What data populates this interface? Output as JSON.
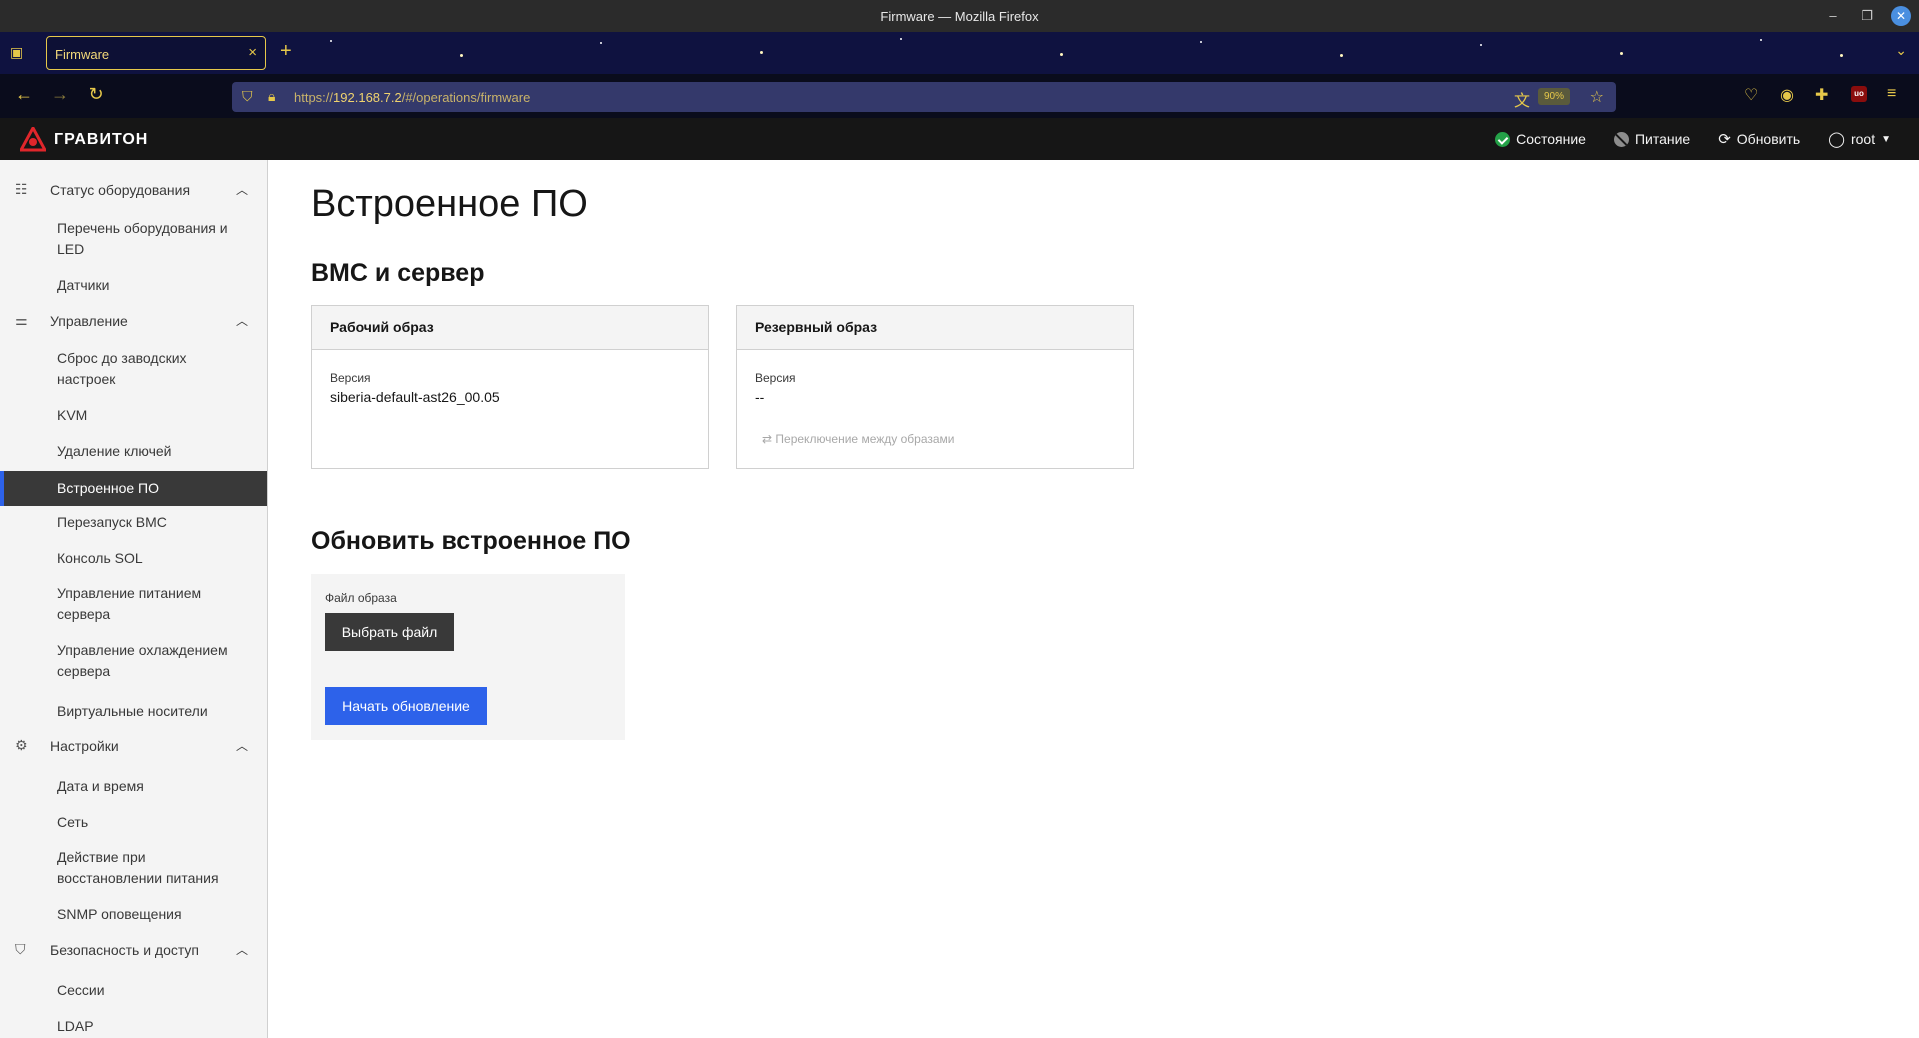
{
  "window": {
    "title": "Firmware — Mozilla Firefox"
  },
  "browser": {
    "tab_title": "Firmware",
    "tab_close": "×",
    "new_tab": "+",
    "url_prefix": "https://",
    "url_host": "192.168.7.2",
    "url_path": "/#/operations/firmware",
    "zoom": "90%"
  },
  "app": {
    "logo_text": "ГРАВИТОН",
    "header": {
      "status": "Состояние",
      "power": "Питание",
      "refresh": "Обновить",
      "user": "root"
    }
  },
  "sidebar": {
    "groups": {
      "hardware": {
        "label": "Статус оборудования"
      },
      "control": {
        "label": "Управление"
      },
      "settings": {
        "label": "Настройки"
      },
      "security": {
        "label": "Безопасность и доступ"
      }
    },
    "items": {
      "inventory": "Перечень оборудования и LED",
      "sensors": "Датчики",
      "factory_reset": "Сброс до заводских настроек",
      "kvm": "KVM",
      "key_clear": "Удаление ключей",
      "firmware": "Встроенное ПО",
      "reboot_bmc": "Перезапуск BMC",
      "sol": "Консоль SOL",
      "power_control": "Управление питанием сервера",
      "cooling": "Управление охлаждением сервера",
      "virtual_media": "Виртуальные носители",
      "datetime": "Дата и время",
      "network": "Сеть",
      "power_restore": "Действие при восстановлении питания",
      "snmp": "SNMP оповещения",
      "sessions": "Сессии",
      "ldap": "LDAP"
    }
  },
  "main": {
    "page_title": "Встроенное ПО",
    "section_bmc": "BMC и сервер",
    "running_card": {
      "title": "Рабочий образ",
      "version_label": "Версия",
      "version": "siberia-default-ast26_00.05"
    },
    "backup_card": {
      "title": "Резервный образ",
      "version_label": "Версия",
      "version": "--",
      "switch_label": "Переключение между образами"
    },
    "section_update": "Обновить встроенное ПО",
    "update": {
      "file_label": "Файл образа",
      "choose_file": "Выбрать файл",
      "start_update": "Начать обновление"
    }
  },
  "colors": {
    "accent": "#2d62ea",
    "ok": "#24a148",
    "header_bg": "#161616"
  }
}
